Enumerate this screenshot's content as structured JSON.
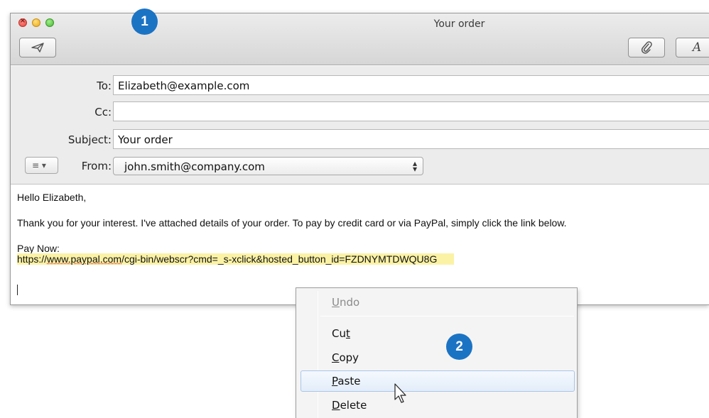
{
  "window": {
    "title": "Your order",
    "toolbar": {
      "send_icon": "paper-plane-icon",
      "attach_icon": "paperclip-icon",
      "format_label": "A"
    }
  },
  "headers": {
    "to_label": "To:",
    "to_value": "Elizabeth@example.com",
    "cc_label": "Cc:",
    "cc_value": "",
    "subject_label": "Subject:",
    "subject_value": "Your order",
    "list_button": "≡ ▾",
    "from_label": "From:",
    "from_value": "john.smith@company.com"
  },
  "body": {
    "greeting": "Hello Elizabeth,",
    "paragraph": "Thank you for your interest. I've attached details of your order. To pay by credit card or via PayPal, simply click the link below.",
    "pay_now": "Pay Now:",
    "link_prefix": "https://",
    "link_spell": "www.paypal.com",
    "link_rest": "/cgi-bin/webscr?cmd=_s-xclick&hosted_button_id=FZDNYMTDWQU8G"
  },
  "context_menu": {
    "undo": {
      "pre": "",
      "accel": "U",
      "post": "ndo",
      "enabled": false
    },
    "cut": {
      "pre": "Cu",
      "accel": "t",
      "post": ""
    },
    "copy": {
      "pre": "",
      "accel": "C",
      "post": "opy"
    },
    "paste": {
      "pre": "",
      "accel": "P",
      "post": "aste",
      "highlighted": true
    },
    "delete": {
      "pre": "",
      "accel": "D",
      "post": "elete"
    }
  },
  "badges": {
    "step1": "1",
    "step2": "2"
  },
  "colors": {
    "badge": "#1b73c4",
    "link_highlight": "#fbf2a6",
    "menu_hover_border": "#a9c4e6"
  }
}
